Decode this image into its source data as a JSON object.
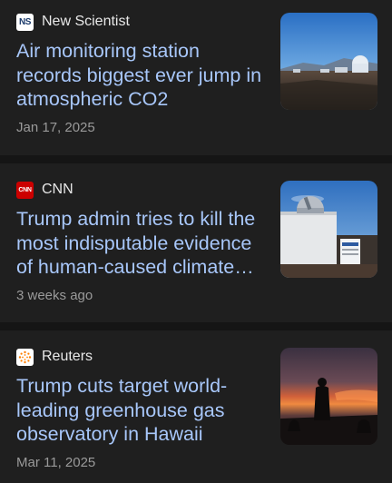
{
  "articles": [
    {
      "source": "New Scientist",
      "logo_text": "NS",
      "logo_color": "#ffffff",
      "headline": "Air monitoring station records biggest ever jump in atmospheric CO2",
      "meta": "Jan 17, 2025",
      "thumbnail": "observatory-landscape"
    },
    {
      "source": "CNN",
      "logo_text": "CNN",
      "logo_color": "#cc0000",
      "headline": "Trump admin tries to kill the most indisputable evidence of human-caused climate…",
      "meta": "3 weeks ago",
      "thumbnail": "observatory-dome"
    },
    {
      "source": "Reuters",
      "logo_text": "",
      "logo_color": "#ff8000",
      "headline": "Trump cuts target world-leading greenhouse gas observatory in Hawaii",
      "meta": "Mar 11, 2025",
      "thumbnail": "sunset-silhouette"
    }
  ],
  "colors": {
    "background": "#1f1f1f",
    "divider": "#151515",
    "headline": "#a8c7fa",
    "meta": "#9a9a9a"
  }
}
